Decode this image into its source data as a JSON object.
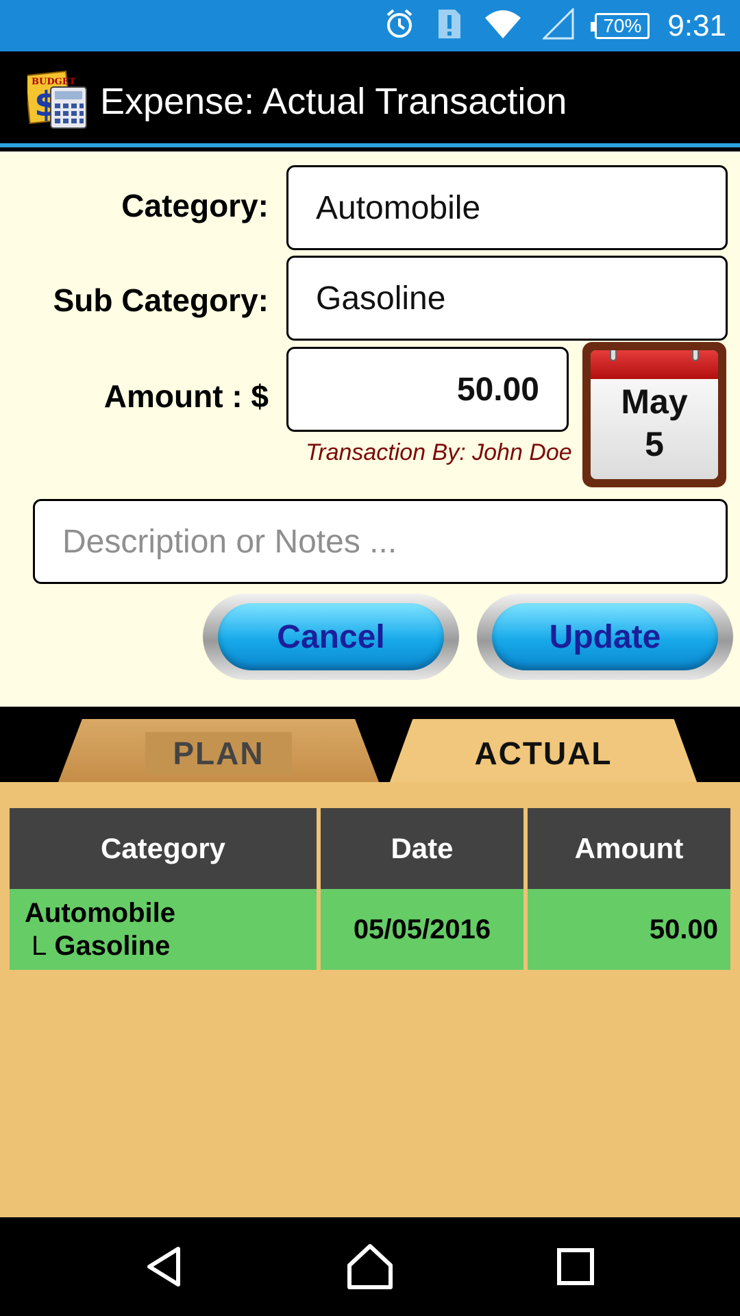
{
  "status_bar": {
    "battery_percent": "70%",
    "time": "9:31",
    "icons": [
      "alarm-icon",
      "notification-alert-icon",
      "wifi-icon",
      "cell-signal-icon",
      "battery-icon"
    ]
  },
  "app_bar": {
    "title": "Expense: Actual Transaction",
    "logo_icon": "budget-calculator-logo-icon"
  },
  "form": {
    "category_label": "Category:",
    "category_value": "Automobile",
    "subcategory_label": "Sub Category:",
    "subcategory_value": "Gasoline",
    "amount_label": "Amount : $",
    "amount_value": "50.00",
    "transaction_by": "Transaction By: John Doe",
    "date_month": "May",
    "date_day": "5",
    "notes_placeholder": "Description or Notes ...",
    "cancel_label": "Cancel",
    "update_label": "Update"
  },
  "tabs": {
    "plan_label": "PLAN",
    "actual_label": "ACTUAL",
    "active": "ACTUAL"
  },
  "table": {
    "headers": [
      "Category",
      "Date",
      "Amount"
    ],
    "rows": [
      {
        "category": "Automobile",
        "subcategory": "Gasoline",
        "sub_prefix": "L",
        "date": "05/05/2016",
        "amount": "50.00"
      }
    ]
  },
  "nav_bar": {
    "icons": [
      "back-icon",
      "home-icon",
      "recents-icon"
    ]
  },
  "colors": {
    "status_bar": "#1a8ad8",
    "app_bar": "#000000",
    "accent_line": "#2ba3e0",
    "form_bg": "#fffde3",
    "folder_bg": "#edc275",
    "table_header": "#424242",
    "table_row": "#66cc66",
    "button_blue": "#17a9ea",
    "transaction_by_text": "#7a0a0a"
  }
}
